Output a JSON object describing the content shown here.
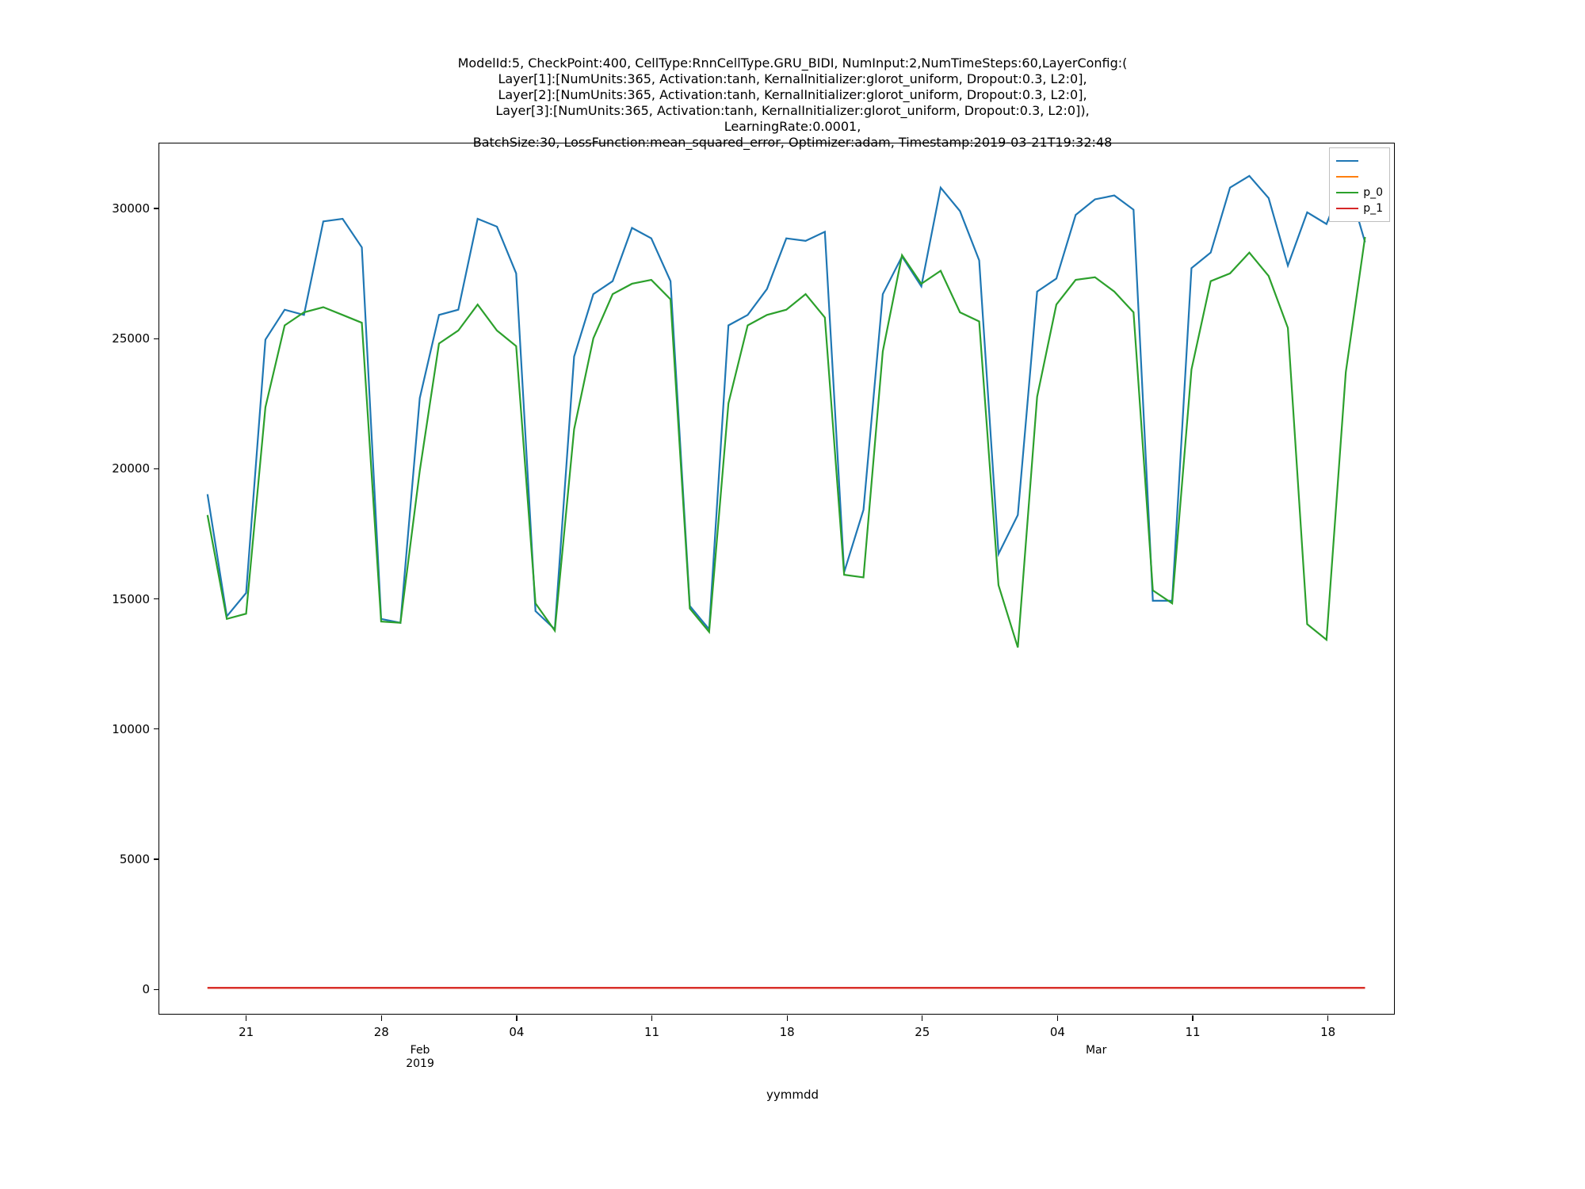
{
  "chart_data": {
    "type": "line",
    "title_lines": [
      "ModelId:5, CheckPoint:400, CellType:RnnCellType.GRU_BIDI, NumInput:2,NumTimeSteps:60,LayerConfig:(",
      "Layer[1]:[NumUnits:365, Activation:tanh, KernalInitializer:glorot_uniform, Dropout:0.3, L2:0],",
      "Layer[2]:[NumUnits:365, Activation:tanh, KernalInitializer:glorot_uniform, Dropout:0.3, L2:0],",
      "Layer[3]:[NumUnits:365, Activation:tanh, KernalInitializer:glorot_uniform, Dropout:0.3, L2:0]),",
      "LearningRate:0.0001,",
      "BatchSize:30, LossFunction:mean_squared_error, Optimizer:adam, Timestamp:2019-03-21T19:32:48"
    ],
    "xlabel": "yymmdd",
    "ylabel": "",
    "ylim": [
      -1000,
      32500
    ],
    "xlim_days": [
      -2.5,
      61.5
    ],
    "yticks": [
      0,
      5000,
      10000,
      15000,
      20000,
      25000,
      30000
    ],
    "ytick_labels": [
      "0",
      "5000",
      "10000",
      "15000",
      "20000",
      "25000",
      "30000"
    ],
    "xticks_days": [
      2,
      9,
      16,
      23,
      30,
      37,
      44,
      51,
      58
    ],
    "xtick_labels": [
      "21",
      "28",
      "04",
      "11",
      "18",
      "25",
      "04",
      "11",
      "18"
    ],
    "xsub_ticks_days": [
      11,
      46
    ],
    "xsub_labels": [
      "Feb\n2019",
      "Mar"
    ],
    "x_days": [
      0,
      1,
      2,
      3,
      4,
      5,
      6,
      7,
      8,
      9,
      10,
      11,
      12,
      13,
      14,
      15,
      16,
      17,
      18,
      19,
      20,
      21,
      22,
      23,
      24,
      25,
      26,
      27,
      28,
      29,
      30,
      31,
      32,
      33,
      34,
      35,
      36,
      37,
      38,
      39,
      40,
      41,
      42,
      43,
      44,
      45,
      46,
      47,
      48,
      49,
      50,
      51,
      52,
      53,
      54,
      55,
      56,
      57,
      58,
      59,
      60
    ],
    "legend": [
      "",
      "",
      "p_0",
      "p_1"
    ],
    "legend_colors": [
      "#1f77b4",
      "#ff7f0e",
      "#2ca02c",
      "#d62728"
    ],
    "series": [
      {
        "name": "",
        "color": "#1f77b4",
        "y": [
          19000,
          14300,
          15200,
          24950,
          26100,
          25900,
          29500,
          29600,
          28500,
          14200,
          14050,
          22700,
          25900,
          26100,
          29600,
          29300,
          27500,
          14500,
          13800,
          24300,
          26700,
          27200,
          29250,
          28850,
          27200,
          14700,
          13800,
          25500,
          25900,
          26900,
          28850,
          28750,
          29100,
          16000,
          18400,
          26700,
          28150,
          27000,
          30800,
          29900,
          28000,
          16700,
          18200,
          26800,
          27300,
          29750,
          30350,
          30500,
          29950,
          14900,
          14900,
          27700,
          28300,
          30800,
          31250,
          30400,
          27800,
          29850,
          29400,
          31250,
          28700
        ]
      },
      {
        "name": "",
        "color": "#ff7f0e",
        "y": [
          0,
          0,
          0,
          0,
          0,
          0,
          0,
          0,
          0,
          0,
          0,
          0,
          0,
          0,
          0,
          0,
          0,
          0,
          0,
          0,
          0,
          0,
          0,
          0,
          0,
          0,
          0,
          0,
          0,
          0,
          0,
          0,
          0,
          0,
          0,
          0,
          0,
          0,
          0,
          0,
          0,
          0,
          0,
          0,
          0,
          0,
          0,
          0,
          0,
          0,
          0,
          0,
          0,
          0,
          0,
          0,
          0,
          0,
          0,
          0,
          0
        ]
      },
      {
        "name": "p_0",
        "color": "#2ca02c",
        "y": [
          18200,
          14200,
          14400,
          22350,
          25500,
          26000,
          26200,
          25900,
          25600,
          14100,
          14050,
          19900,
          24800,
          25300,
          26300,
          25300,
          24700,
          14800,
          13750,
          21500,
          25000,
          26700,
          27100,
          27250,
          26500,
          14600,
          13700,
          22500,
          25500,
          25900,
          26100,
          26700,
          25800,
          15900,
          15800,
          24500,
          28200,
          27100,
          27600,
          26000,
          25650,
          15500,
          13100,
          22750,
          26300,
          27250,
          27350,
          26800,
          26000,
          15300,
          14800,
          23800,
          27200,
          27500,
          28300,
          27400,
          25400,
          14000,
          13400,
          23700,
          28900
        ]
      },
      {
        "name": "p_1",
        "color": "#d62728",
        "y": [
          0,
          0,
          0,
          0,
          0,
          0,
          0,
          0,
          0,
          0,
          0,
          0,
          0,
          0,
          0,
          0,
          0,
          0,
          0,
          0,
          0,
          0,
          0,
          0,
          0,
          0,
          0,
          0,
          0,
          0,
          0,
          0,
          0,
          0,
          0,
          0,
          0,
          0,
          0,
          0,
          0,
          0,
          0,
          0,
          0,
          0,
          0,
          0,
          0,
          0,
          0,
          0,
          0,
          0,
          0,
          0,
          0,
          0,
          0,
          0,
          0
        ]
      }
    ]
  }
}
